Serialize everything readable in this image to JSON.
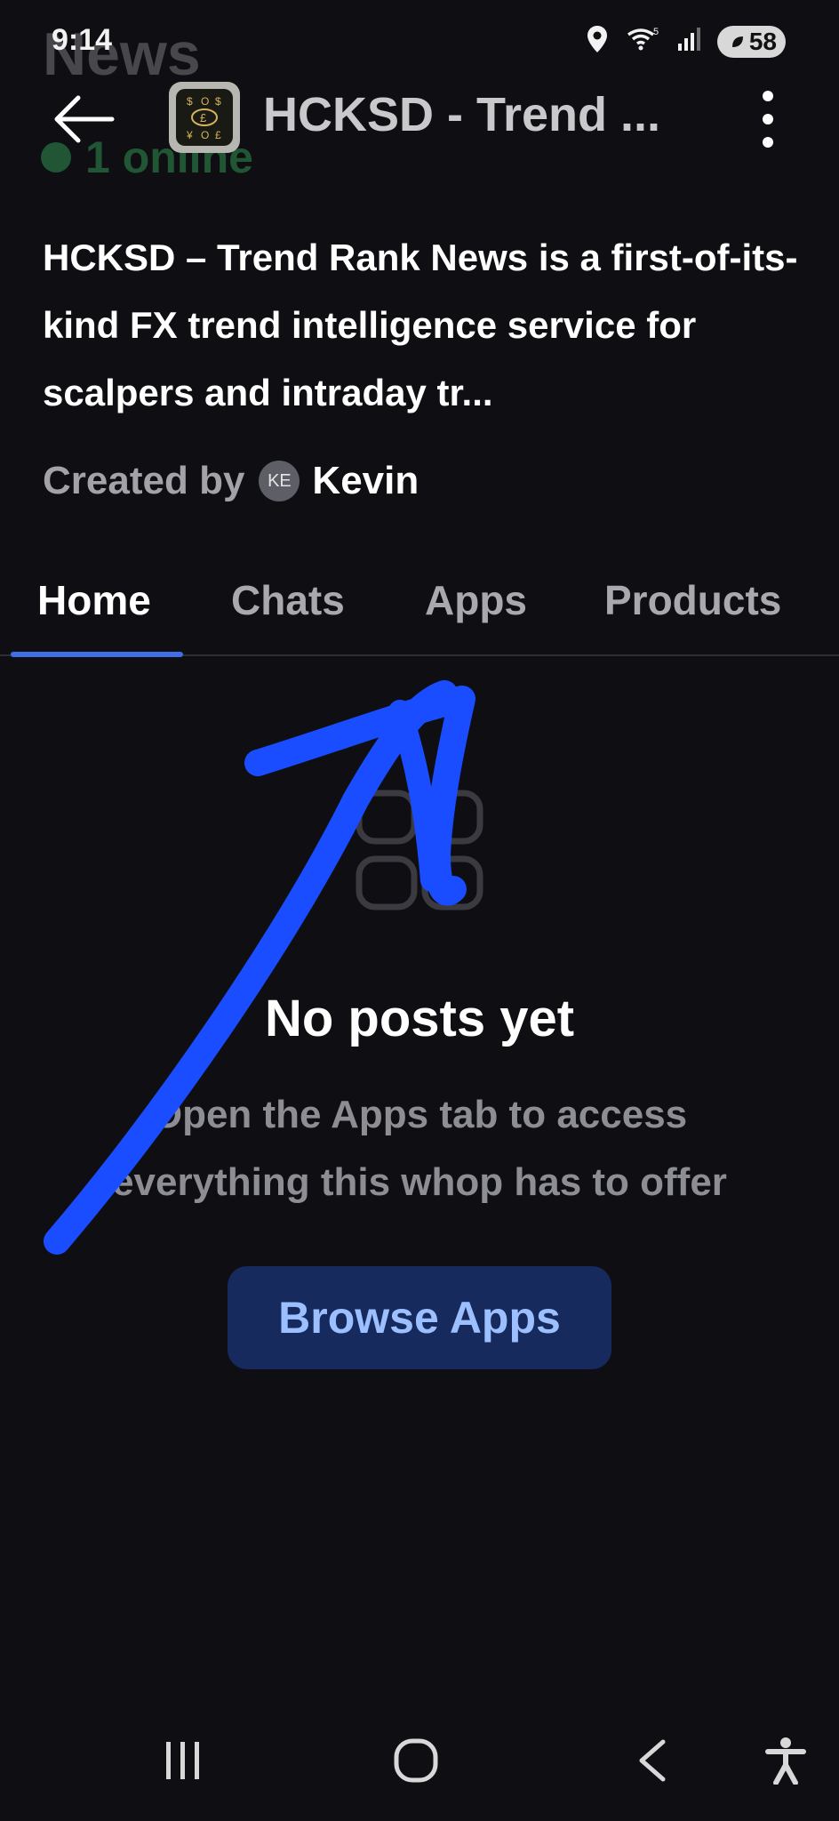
{
  "status_bar": {
    "time": "9:14",
    "signal_label": "5",
    "battery": "58"
  },
  "ghost_overlay": {
    "title": "News",
    "online": "1 online"
  },
  "header": {
    "title": "HCKSD - Trend ...",
    "icon_symbols": [
      "$",
      "O",
      "$",
      "£",
      "¥",
      "O",
      "£"
    ]
  },
  "description": "HCKSD – Trend Rank News is a first-of-its-kind FX trend intelligence service for scalpers and intraday tr...",
  "creator": {
    "label": "Created by",
    "initials": "KE",
    "name": "Kevin"
  },
  "tabs": [
    {
      "label": "Home",
      "active": true
    },
    {
      "label": "Chats",
      "active": false
    },
    {
      "label": "Apps",
      "active": false
    },
    {
      "label": "Products",
      "active": false
    }
  ],
  "empty_state": {
    "title": "No posts yet",
    "subtitle": "Open the Apps tab to access everything this whop has to offer",
    "button": "Browse Apps"
  },
  "colors": {
    "background": "#0f0e13",
    "accent": "#3f6ee6",
    "button_bg": "#162a5e",
    "button_text": "#9cc0ff",
    "annotation": "#1a4dff"
  }
}
